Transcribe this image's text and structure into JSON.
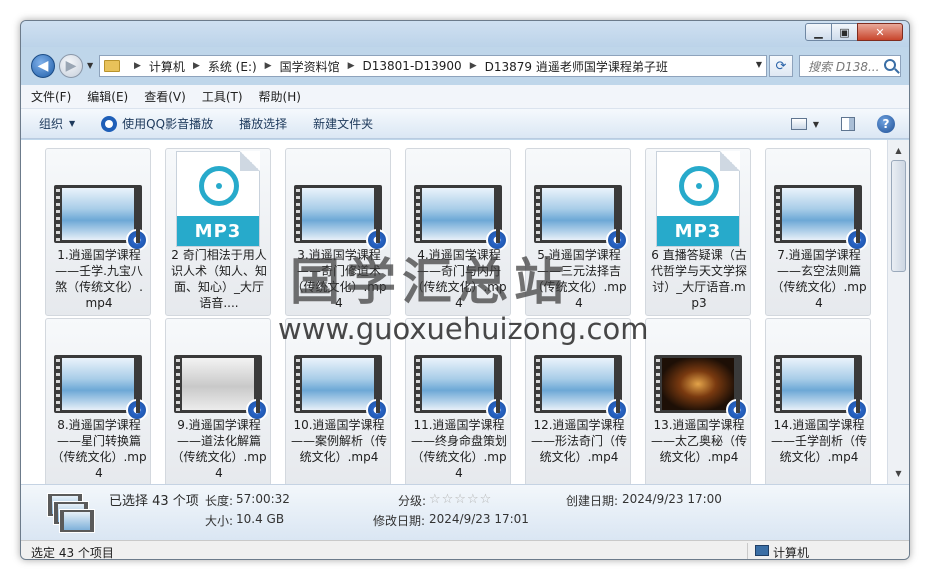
{
  "address": {
    "crumbs": [
      "计算机",
      "系统 (E:)",
      "国学资料馆",
      "D13801-D13900",
      "D13879 逍遥老师国学课程弟子班"
    ],
    "search_placeholder": "搜索 D138..."
  },
  "menu": [
    "文件(F)",
    "编辑(E)",
    "查看(V)",
    "工具(T)",
    "帮助(H)"
  ],
  "toolbar": {
    "organize": "组织",
    "qq_play": "使用QQ影音播放",
    "play_selected": "播放选择",
    "new_folder": "新建文件夹"
  },
  "files": [
    {
      "name": "1.逍遥国学课程——壬学.九宝八煞（传统文化）.mp4",
      "type": "video",
      "thumb": "blue"
    },
    {
      "name": "2 奇门相法于用人识人术（知人、知面、知心）_大厅语音....",
      "type": "mp3"
    },
    {
      "name": "3.逍遥国学课程——奇门修道术（传统文化）.mp4",
      "type": "video",
      "thumb": "blue"
    },
    {
      "name": "4.逍遥国学课程——奇门与内丹（传统文化）.mp4",
      "type": "video",
      "thumb": "blue"
    },
    {
      "name": "5.逍遥国学课程——三元法择吉（传统文化）.mp4",
      "type": "video",
      "thumb": "blue"
    },
    {
      "name": "6 直播答疑课（古代哲学与天文学探讨）_大厅语音.mp3",
      "type": "mp3"
    },
    {
      "name": "7.逍遥国学课程——玄空法则篇（传统文化）.mp4",
      "type": "video",
      "thumb": "blue"
    },
    {
      "name": "8.逍遥国学课程——星门转换篇（传统文化）.mp4",
      "type": "video",
      "thumb": "blue"
    },
    {
      "name": "9.逍遥国学课程——道法化解篇（传统文化）.mp4",
      "type": "video",
      "thumb": "gray"
    },
    {
      "name": "10.逍遥国学课程——案例解析（传统文化）.mp4",
      "type": "video",
      "thumb": "blue"
    },
    {
      "name": "11.逍遥国学课程——终身命盘策划（传统文化）.mp4",
      "type": "video",
      "thumb": "blue"
    },
    {
      "name": "12.逍遥国学课程——形法奇门（传统文化）.mp4",
      "type": "video",
      "thumb": "blue"
    },
    {
      "name": "13.逍遥国学课程——太乙奥秘（传统文化）.mp4",
      "type": "video",
      "thumb": "dark"
    },
    {
      "name": "14.逍遥国学课程——壬学剖析（传统文化）.mp4",
      "type": "video",
      "thumb": "blue"
    }
  ],
  "mp3_label": "MP3",
  "watermark": {
    "cn": "国学汇总站",
    "url": "www.guoxuehuizong.com"
  },
  "details": {
    "selected": "已选择 43 个项",
    "length_label": "长度:",
    "length_value": "57:00:32",
    "size_label": "大小:",
    "size_value": "10.4 GB",
    "rating_label": "分级:",
    "rating_stars": "☆☆☆☆☆",
    "modified_label": "修改日期:",
    "modified_value": "2024/9/23 17:01",
    "created_label": "创建日期:",
    "created_value": "2024/9/23 17:00"
  },
  "status": {
    "left": "选定 43 个项目",
    "right": "计算机"
  }
}
